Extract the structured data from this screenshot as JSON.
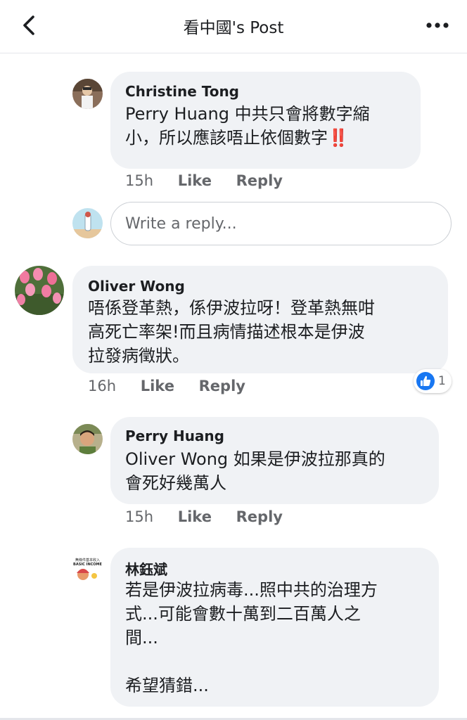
{
  "header": {
    "title": "看中國's Post"
  },
  "comments": [
    {
      "author": "Christine Tong",
      "text": "Perry Huang 中共只會將數字縮\n小，所以應該唔止依個數字‼️",
      "time": "15h",
      "like": "Like",
      "reply": "Reply"
    },
    {
      "author": "Oliver Wong",
      "text": "唔係登革熱，係伊波拉呀！登革熱無咁\n高死亡率架!而且病情描述根本是伊波\n拉發病徵狀。",
      "time": "16h",
      "like": "Like",
      "reply": "Reply",
      "reaction_count": "1"
    },
    {
      "author": "Perry Huang",
      "text": "Oliver Wong 如果是伊波拉那真的\n會死好幾萬人",
      "time": "15h",
      "like": "Like",
      "reply": "Reply"
    },
    {
      "author": "林鈺斌",
      "text": "若是伊波拉病毒...照中共的治理方\n式...可能會數十萬到二百萬人之\n間...\n\n希望猜錯...",
      "time": "",
      "like": "",
      "reply": ""
    }
  ],
  "reply_box": {
    "placeholder": "Write a reply..."
  },
  "avatar_text": {
    "basic_income_line1": "無條件基本收入",
    "basic_income_line2": "BASIC INCOME"
  },
  "colors": {
    "bubble": "#f0f2f5",
    "text": "#1c1e21",
    "secondary": "#65676b",
    "like_blue": "#1877f2"
  },
  "icons": {
    "back": "chevron-left-icon",
    "more": "more-dots-icon",
    "reaction": "like-thumb-icon"
  }
}
